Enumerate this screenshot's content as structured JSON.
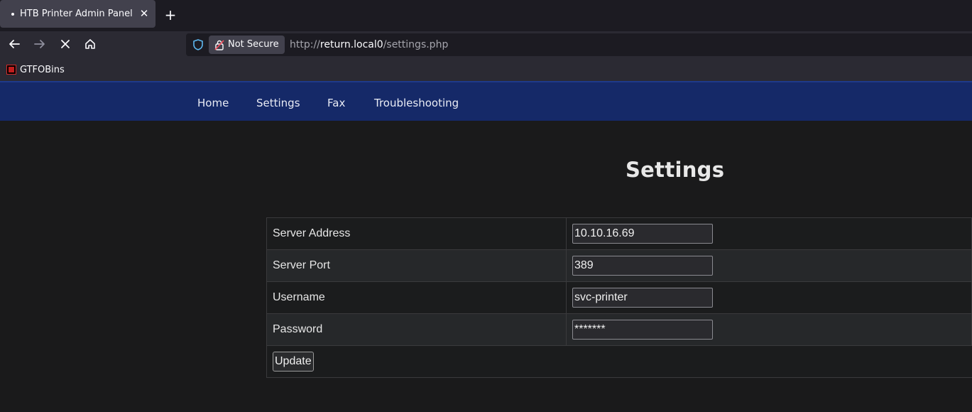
{
  "browser": {
    "tab_title": "HTB Printer Admin Panel",
    "security_label": "Not Secure",
    "url_prefix": "http://",
    "url_host": "return.local0",
    "url_path": "/settings.php",
    "bookmark_label": "GTFOBins"
  },
  "nav": {
    "items": [
      {
        "label": "Home"
      },
      {
        "label": "Settings"
      },
      {
        "label": "Fax"
      },
      {
        "label": "Troubleshooting"
      }
    ]
  },
  "page": {
    "title": "Settings"
  },
  "form": {
    "rows": [
      {
        "label": "Server Address",
        "value": "10.10.16.69"
      },
      {
        "label": "Server Port",
        "value": "389"
      },
      {
        "label": "Username",
        "value": "svc-printer"
      },
      {
        "label": "Password",
        "value": "*******"
      }
    ],
    "submit_label": "Update"
  }
}
